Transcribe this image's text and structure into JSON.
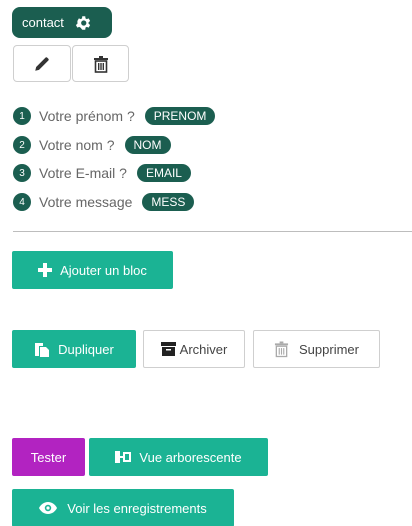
{
  "header": {
    "contact_label": "contact"
  },
  "toolbar": {
    "edit_icon": "pencil-icon",
    "delete_icon": "trash-icon"
  },
  "fields": [
    {
      "number": "1",
      "label": "Votre prénom ?",
      "tag": "PRENOM"
    },
    {
      "number": "2",
      "label": "Votre nom ?",
      "tag": "NOM"
    },
    {
      "number": "3",
      "label": "Votre E-mail ?",
      "tag": "EMAIL"
    },
    {
      "number": "4",
      "label": "Votre message",
      "tag": "MESS"
    }
  ],
  "actions": {
    "add_block": "Ajouter un bloc",
    "duplicate": "Dupliquer",
    "archive": "Archiver",
    "delete": "Supprimer",
    "test": "Tester",
    "tree_view": "Vue arborescente",
    "records": "Voir les enregistrements"
  },
  "colors": {
    "dark_green": "#1b5e50",
    "green": "#1bb394",
    "purple": "#b223c1"
  }
}
